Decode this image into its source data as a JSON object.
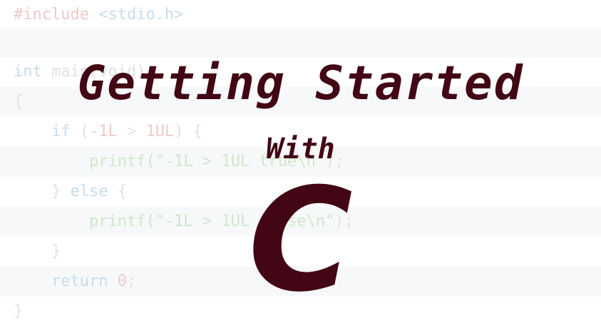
{
  "background_code": {
    "lines": [
      {
        "pp": "#include",
        "rest": " <stdio.h>"
      },
      {
        "text": ""
      },
      {
        "kw": "int",
        "rest": " main(void)"
      },
      {
        "text": "{"
      },
      {
        "indent": "    ",
        "kw": "if",
        "rest_a": " (",
        "num_a": "-1L",
        "rest_b": " > ",
        "num_b": "1UL",
        "rest_c": ") {"
      },
      {
        "indent": "        ",
        "fn": "printf(",
        "str": "\"-1L > 1UL true\\n\"",
        "rest": ");"
      },
      {
        "indent": "    ",
        "text": "} ",
        "kw": "else",
        "rest": " {"
      },
      {
        "indent": "        ",
        "fn": "printf(",
        "str": "\"-1L > 1UL false\\n\"",
        "rest": ");"
      },
      {
        "indent": "    ",
        "text": "}"
      },
      {
        "indent": "    ",
        "kw": "return",
        "rest_a": " ",
        "num": "0",
        "rest_b": ";"
      },
      {
        "text": "}"
      }
    ]
  },
  "title": {
    "line1": "Getting Started",
    "line2": "With",
    "line3": "C"
  },
  "colors": {
    "title": "#420614",
    "stripe": "#f6f8fa"
  }
}
